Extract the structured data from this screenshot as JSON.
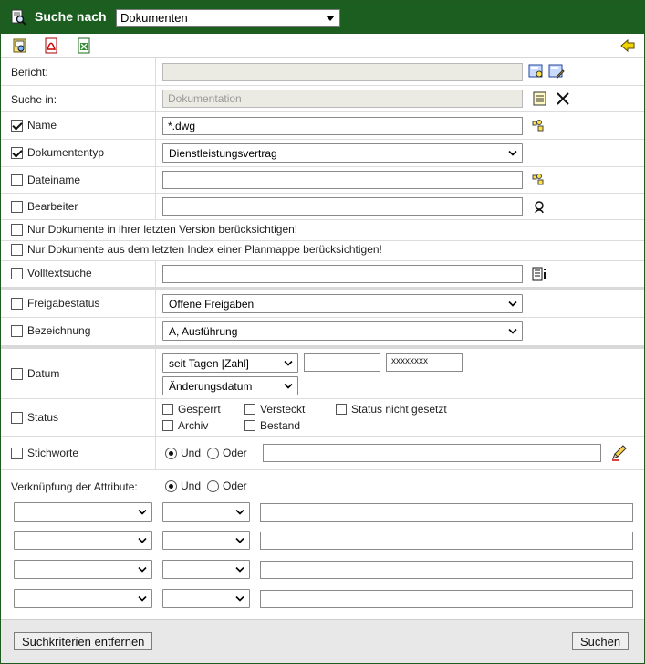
{
  "header": {
    "title": "Suche nach",
    "search_type": "Dokumenten"
  },
  "fields": {
    "bericht": {
      "label": "Bericht:",
      "value": ""
    },
    "suche_in": {
      "label": "Suche in:",
      "value": "Dokumentation"
    },
    "name": {
      "label": "Name",
      "checked": true,
      "value": "*.dwg"
    },
    "dokumententyp": {
      "label": "Dokumententyp",
      "checked": true,
      "value": "Dienstleistungsvertrag"
    },
    "dateiname": {
      "label": "Dateiname",
      "checked": false,
      "value": ""
    },
    "bearbeiter": {
      "label": "Bearbeiter",
      "checked": false,
      "value": ""
    },
    "letzte_version": {
      "label": "Nur Dokumente in ihrer letzten Version berücksichtigen!",
      "checked": false
    },
    "letzter_index": {
      "label": "Nur Dokumente aus dem letzten Index einer Planmappe berücksichtigen!",
      "checked": false
    },
    "volltextsuche": {
      "label": "Volltextsuche",
      "checked": false,
      "value": ""
    },
    "freigabestatus": {
      "label": "Freigabestatus",
      "checked": false,
      "value": "Offene Freigaben"
    },
    "bezeichnung": {
      "label": "Bezeichnung",
      "checked": false,
      "value": "A, Ausführung"
    },
    "datum": {
      "label": "Datum",
      "checked": false,
      "mode": "seit Tagen [Zahl]",
      "from": "",
      "to_placeholder": "xxxxxxxx",
      "date_type": "Änderungsdatum"
    },
    "status": {
      "label": "Status",
      "checked": false,
      "options": [
        "Gesperrt",
        "Versteckt",
        "Status nicht gesetzt",
        "Archiv",
        "Bestand"
      ]
    },
    "stichworte": {
      "label": "Stichworte",
      "checked": false,
      "und": "Und",
      "oder": "Oder",
      "value": ""
    }
  },
  "attribute_link": {
    "label": "Verknüpfung der Attribute:",
    "und": "Und",
    "oder": "Oder"
  },
  "buttons": {
    "clear": "Suchkriterien entfernen",
    "search": "Suchen"
  },
  "colors": {
    "header_bg": "#1b5e20",
    "separator": "#d9d9d9",
    "footer_bg": "#e8e8e8"
  }
}
